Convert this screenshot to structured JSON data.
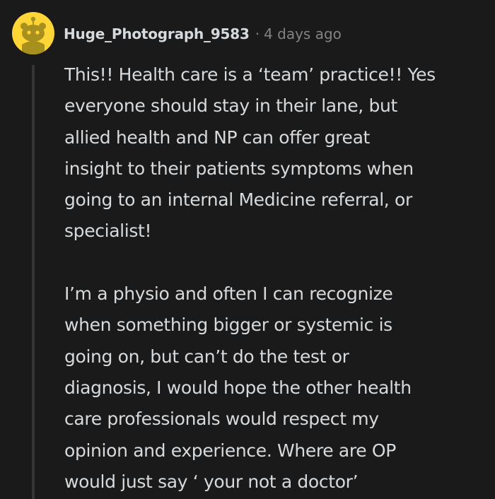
{
  "comment": {
    "username": "Huge_Photograph_9583",
    "separator": "·",
    "timestamp": "4 days ago",
    "avatar_icon": "reddit-snoo-icon",
    "paragraphs": [
      "This!! Health care is a ‘team’ practice!! Yes\neveryone should stay in their lane, but\nallied health and NP can offer great\ninsight to their patients symptoms when\ngoing to an internal Medicine referral, or\nspecialist!",
      "I’m a physio and often I can recognize\nwhen something bigger or systemic is\ngoing on, but can’t do the test or\ndiagnosis, I would hope the other health\ncare professionals would respect my\nopinion and experience. Where are OP\nwould just say ‘ your not a doctor’"
    ]
  },
  "colors": {
    "background": "#1a1a1b",
    "text": "#d7dadc",
    "muted": "#818384",
    "avatar": "#ffd635",
    "snoo": "#a8901e",
    "thread_line": "#343536"
  }
}
